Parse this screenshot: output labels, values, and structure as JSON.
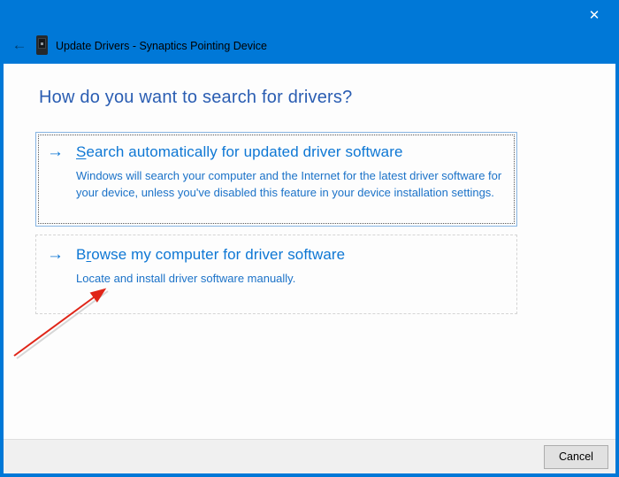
{
  "window": {
    "title": "Update Drivers - Synaptics Pointing Device"
  },
  "icons": {
    "close": "✕",
    "back": "←",
    "link_arrow": "→"
  },
  "heading": "How do you want to search for drivers?",
  "options": [
    {
      "title_pre": "",
      "title_accel": "S",
      "title_post": "earch automatically for updated driver software",
      "description": "Windows will search your computer and the Internet for the latest driver software for your device, unless you've disabled this feature in your device installation settings."
    },
    {
      "title_pre": "B",
      "title_accel": "r",
      "title_post": "owse my computer for driver software",
      "description": "Locate and install driver software manually."
    }
  ],
  "footer": {
    "cancel_label": "Cancel"
  },
  "colors": {
    "accent": "#0078d7",
    "heading_blue": "#2a5db2",
    "link_blue": "#0e77d4",
    "desc_blue": "#1b72c8",
    "annotation_red": "#e02518",
    "footer_bg": "#f0f0f0",
    "button_bg": "#e1e1e1",
    "button_border": "#adadad"
  }
}
